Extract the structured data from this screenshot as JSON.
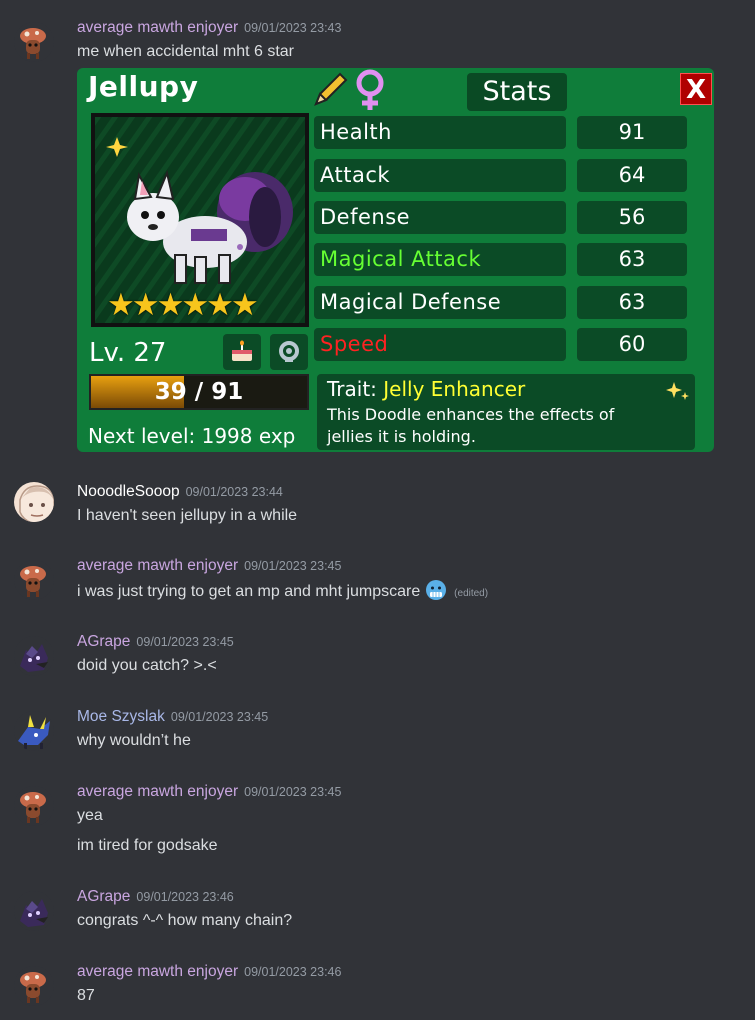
{
  "colors": {
    "background": "#313338",
    "username_default": "#c9a6e0",
    "username_nooodle": "#ffffff",
    "username_moe": "#a9b8e8",
    "timestamp": "#949ba4"
  },
  "messages": [
    {
      "author": "average mawth enjoyer",
      "timestamp": "09/01/2023 23:43",
      "avatar_icon": "mushroom-pet-avatar",
      "lines": [
        "me when accidental mht 6 star"
      ],
      "attachment": {
        "type": "game-screenshot",
        "name": "Jellupy",
        "stats_title": "Stats",
        "close_label": "X",
        "stats": [
          {
            "label": "Health",
            "value": "91",
            "color": "#ffffff"
          },
          {
            "label": "Attack",
            "value": "64",
            "color": "#ffffff"
          },
          {
            "label": "Defense",
            "value": "56",
            "color": "#ffffff"
          },
          {
            "label": "Magical Attack",
            "value": "63",
            "color": "#66ff33"
          },
          {
            "label": "Magical Defense",
            "value": "63",
            "color": "#ffffff"
          },
          {
            "label": "Speed",
            "value": "60",
            "color": "#ff2222"
          }
        ],
        "level": "Lv. 27",
        "hp_text": "39 / 91",
        "hp_fraction": 0.43,
        "next_level": "Next level: 1998 exp",
        "trait_label": "Trait:",
        "trait_name": "Jelly Enhancer",
        "trait_desc_1": "This Doodle enhances the effects of",
        "trait_desc_2": "jellies it is holding.",
        "stars": 6,
        "gender_icon": "female-icon",
        "edit_icon": "pencil-icon"
      }
    },
    {
      "author": "NooodleSooop",
      "timestamp": "09/01/2023 23:44",
      "avatar_icon": "sketch-face-avatar",
      "lines": [
        "I haven't seen jellupy in a while"
      ]
    },
    {
      "author": "average mawth enjoyer",
      "timestamp": "09/01/2023 23:45",
      "avatar_icon": "mushroom-pet-avatar",
      "lines": [
        "i was just trying to get an mp and mht jumpscare"
      ],
      "emoji": "cold-face-emoji",
      "edited": "(edited)"
    },
    {
      "author": "AGrape",
      "timestamp": "09/01/2023 23:45",
      "avatar_icon": "purple-creature-avatar",
      "lines": [
        "doid you catch? >.<"
      ]
    },
    {
      "author": "Moe Szyslak",
      "timestamp": "09/01/2023 23:45",
      "avatar_icon": "blue-creature-avatar",
      "lines": [
        "why wouldn’t he"
      ]
    },
    {
      "author": "average mawth enjoyer",
      "timestamp": "09/01/2023 23:45",
      "avatar_icon": "mushroom-pet-avatar",
      "lines": [
        "yea",
        "im tired for godsake"
      ]
    },
    {
      "author": "AGrape",
      "timestamp": "09/01/2023 23:46",
      "avatar_icon": "purple-creature-avatar",
      "lines": [
        "congrats ^-^ how many chain?"
      ]
    },
    {
      "author": "average mawth enjoyer",
      "timestamp": "09/01/2023 23:46",
      "avatar_icon": "mushroom-pet-avatar",
      "lines": [
        "87"
      ]
    }
  ]
}
